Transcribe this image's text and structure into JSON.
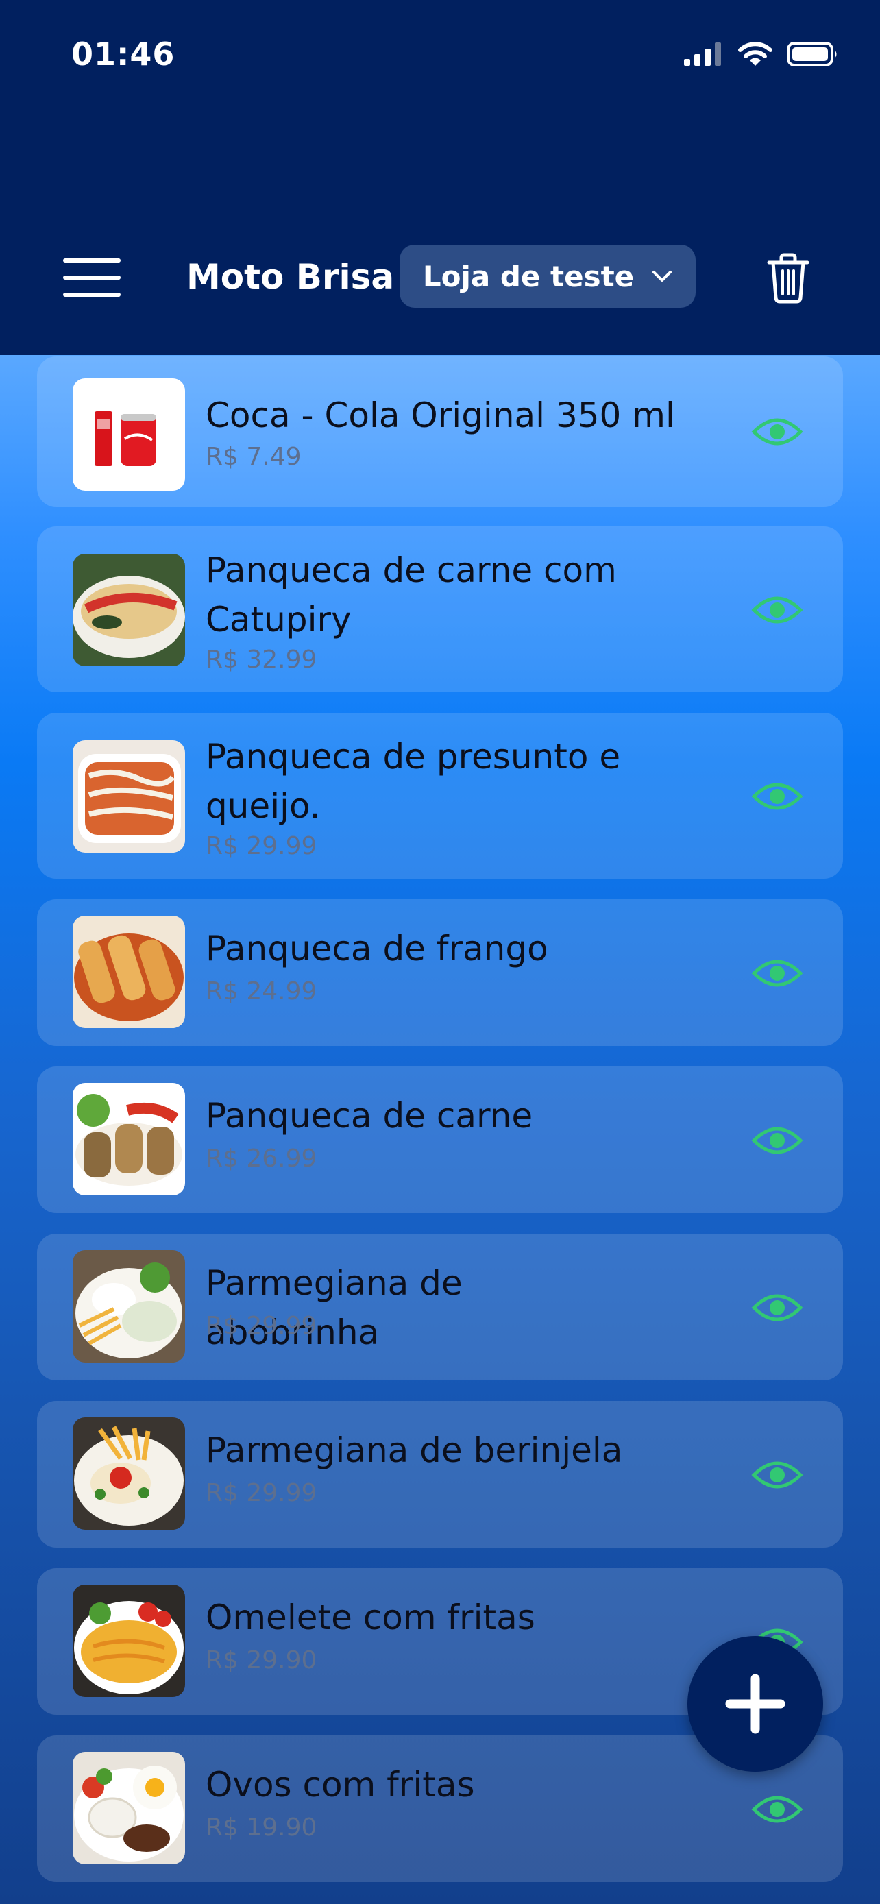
{
  "status_bar": {
    "time": "01:46"
  },
  "header": {
    "title": "Moto Brisa",
    "store_selector": "Loja de teste"
  },
  "colors": {
    "header_bg": "#01205f",
    "visibility_icon": "#32c873",
    "fab_bg": "#01205f"
  },
  "products": [
    {
      "name": "Coca - Cola Original 350 ml",
      "price": "R$ 7.49",
      "visible": true
    },
    {
      "name": "Panqueca de carne com Catupiry",
      "price": "R$ 32.99",
      "visible": true
    },
    {
      "name": "Panqueca de presunto e queijo.",
      "price": "R$ 29.99",
      "visible": true
    },
    {
      "name": "Panqueca de frango",
      "price": "R$ 24.99",
      "visible": true
    },
    {
      "name": "Panqueca de carne",
      "price": "R$ 26.99",
      "visible": true
    },
    {
      "name": "Parmegiana de abobrinha",
      "price": "R$ 29.99",
      "visible": true
    },
    {
      "name": "Parmegiana de berinjela",
      "price": "R$ 29.99",
      "visible": true
    },
    {
      "name": "Omelete com fritas",
      "price": "R$ 29.90",
      "visible": true
    },
    {
      "name": "Ovos com fritas",
      "price": "R$ 19.90",
      "visible": true
    }
  ],
  "icons": {
    "menu": "hamburger-icon",
    "dropdown": "chevron-down-icon",
    "delete": "trash-icon",
    "visibility": "eye-icon",
    "add": "plus-icon"
  }
}
